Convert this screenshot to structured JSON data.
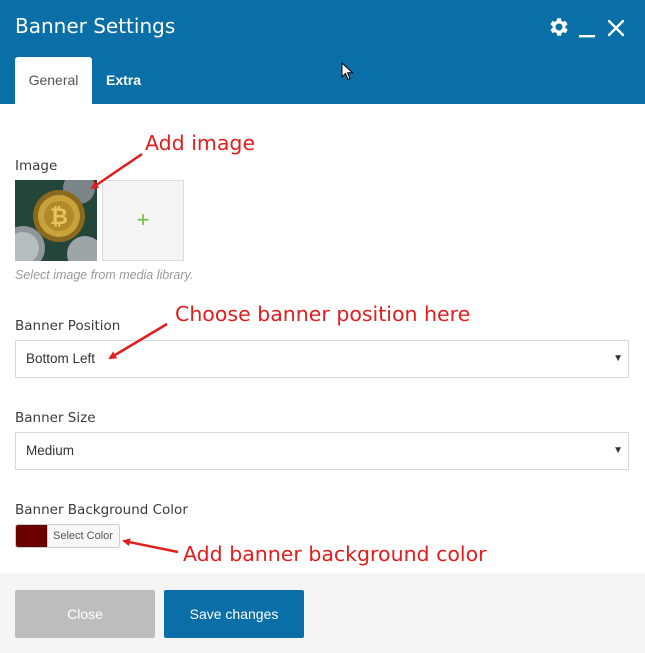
{
  "header": {
    "title": "Banner Settings",
    "color": "#0a6fa6",
    "icons": [
      "gear-icon",
      "minimize-icon",
      "close-icon"
    ]
  },
  "tabs": [
    {
      "label": "General",
      "active": true
    },
    {
      "label": "Extra",
      "active": false
    }
  ],
  "form": {
    "image_label": "Image",
    "image_add_glyph": "+",
    "image_help": "Select image from media library.",
    "position_label": "Banner Position",
    "position_value": "Bottom Left",
    "size_label": "Banner Size",
    "size_value": "Medium",
    "bg_label": "Banner Background Color",
    "bg_button_label": "Select Color",
    "bg_color": "#6b0000",
    "caret_glyph": "▼"
  },
  "annotations": {
    "image": "Add image",
    "position": "Choose banner position here",
    "bg": "Add banner background color"
  },
  "footer": {
    "close_label": "Close",
    "save_label": "Save changes"
  }
}
